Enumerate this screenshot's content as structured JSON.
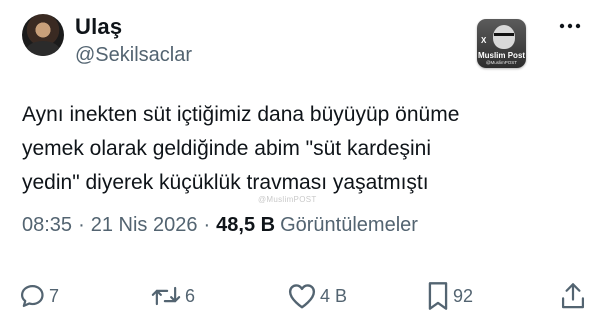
{
  "author": {
    "display_name": "Ulaş",
    "handle": "@Sekilsaclar",
    "avatar_icon": "profile-photo"
  },
  "watermark_badge": {
    "line1": "Muslim Post",
    "line2": "@MuslimPOST",
    "x_mark": "X",
    "colors": {
      "background": "#3a3a3a",
      "text": "#ffffff"
    }
  },
  "tweet": {
    "lines": [
      "Aynı inekten süt içtiğimiz dana büyüyüp önüme",
      "yemek olarak geldiğinde abim \"süt kardeşini",
      "yedin\" diyerek küçüklük travması yaşatmıştı"
    ]
  },
  "overlay_watermark": "@MuslimPOST",
  "meta": {
    "time": "08:35",
    "separator": "·",
    "date": "21 Nis 2026",
    "views_count": "48,5 B",
    "views_label": "Görüntülemeler"
  },
  "actions": {
    "reply": {
      "icon": "reply-icon",
      "count": "7"
    },
    "retweet": {
      "icon": "retweet-icon",
      "count": "6"
    },
    "like": {
      "icon": "heart-icon",
      "count": "4 B"
    },
    "bookmark": {
      "icon": "bookmark-icon",
      "count": "92"
    },
    "share": {
      "icon": "share-icon"
    }
  },
  "colors": {
    "text_primary": "#0f1419",
    "text_secondary": "#536471",
    "background": "#ffffff"
  }
}
